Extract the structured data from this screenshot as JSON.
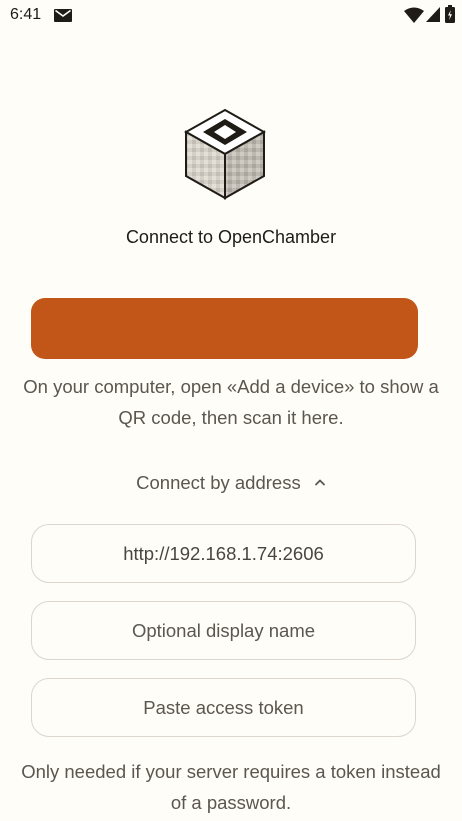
{
  "status_bar": {
    "time": "6:41",
    "icons": [
      "mail-icon",
      "wifi-icon",
      "signal-icon",
      "battery-icon"
    ]
  },
  "connect": {
    "logo_icon": "openchamber-cube-icon",
    "title": "Connect to OpenChamber",
    "scan_button_label": "",
    "scan_help": "On your computer, open «Add a device» to show a QR code, then scan it here.",
    "accent_color": "#c15618"
  },
  "manual": {
    "toggle_label": "Connect by address",
    "toggle_icon": "chevron-up-icon",
    "url_value": "http://192.168.1.74:2606",
    "display_name_placeholder": "Optional display name",
    "token_placeholder": "Paste access token",
    "token_help": "Only needed if your server requires a token instead of a password."
  }
}
